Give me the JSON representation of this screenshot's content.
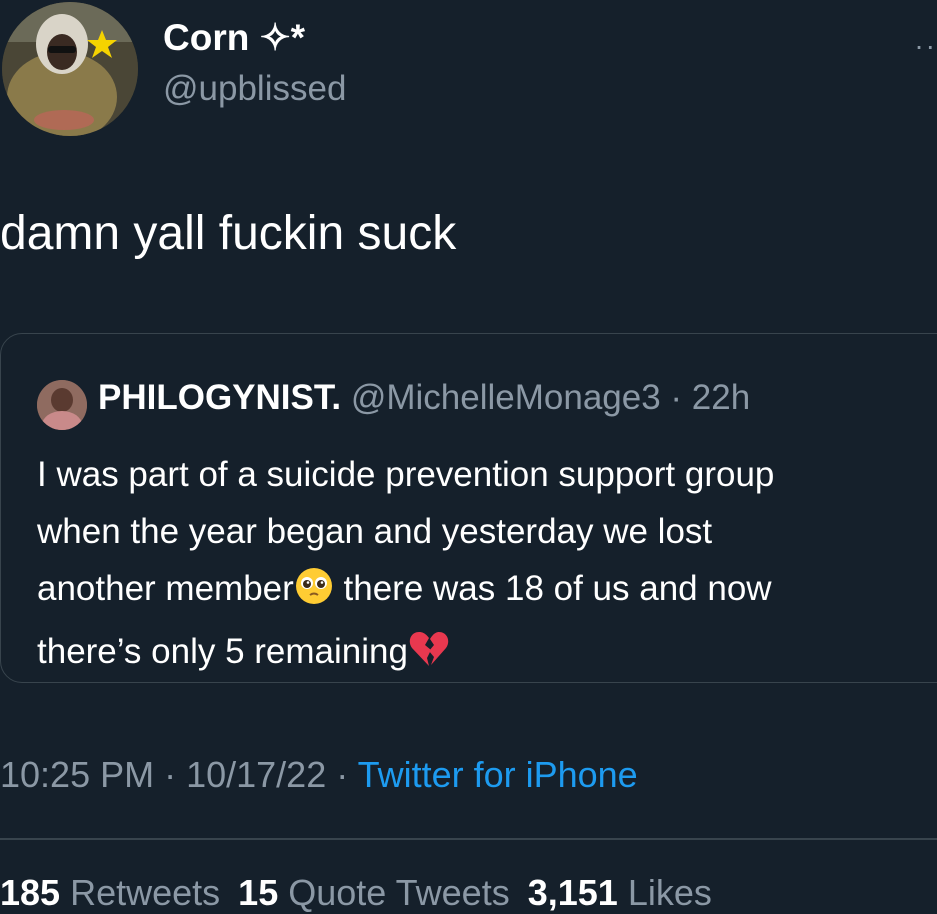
{
  "author": {
    "name": "Corn ✧*",
    "handle": "@upblissed"
  },
  "tweet": {
    "text": "damn yall fuckin suck"
  },
  "quote": {
    "name": "PHILOGYNIST.",
    "handle": "@MichelleMonage3",
    "separator": " · ",
    "time": "22h",
    "lines": [
      "I was part of a suicide prevention support group",
      "when the year began and yesterday we lost",
      "another member",
      " there was 18 of us and now",
      "there’s only 5 remaining"
    ],
    "emojis": [
      "pleading-face",
      "broken-heart"
    ]
  },
  "meta": {
    "time": "10:25 PM",
    "separator": " · ",
    "date": "10/17/22",
    "source": "Twitter for iPhone"
  },
  "stats": {
    "retweets_count": "185",
    "retweets_label": "Retweets",
    "quotes_count": "15",
    "quotes_label": "Quote Tweets",
    "likes_count": "3,151",
    "likes_label": "Likes"
  },
  "colors": {
    "background": "#15202b",
    "text": "#ffffff",
    "muted": "#8b98a5",
    "link": "#1d9bf0",
    "border": "#38444d"
  }
}
